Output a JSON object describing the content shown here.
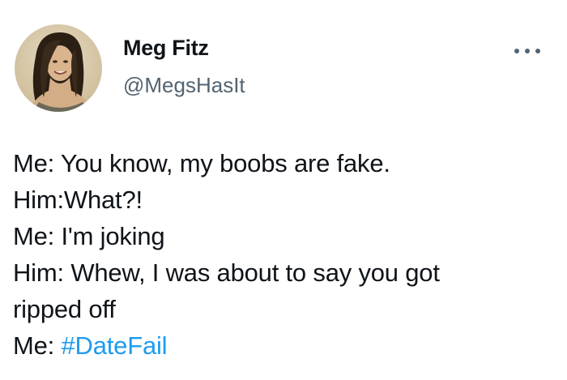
{
  "user": {
    "display_name": "Meg Fitz",
    "handle": "@MegsHasIt",
    "avatar_icon": "profile-photo"
  },
  "more_icon": "more-horizontal-icon",
  "tweet": {
    "lines": [
      "Me: You know, my boobs are fake.",
      "Him:What?!",
      "Me: I'm joking",
      "Him: Whew, I was about to say you got",
      "ripped off"
    ],
    "last_line_prefix": "Me: ",
    "hashtag": "#DateFail"
  },
  "colors": {
    "text": "#0f1419",
    "secondary": "#536471",
    "link": "#1d9bf0"
  }
}
